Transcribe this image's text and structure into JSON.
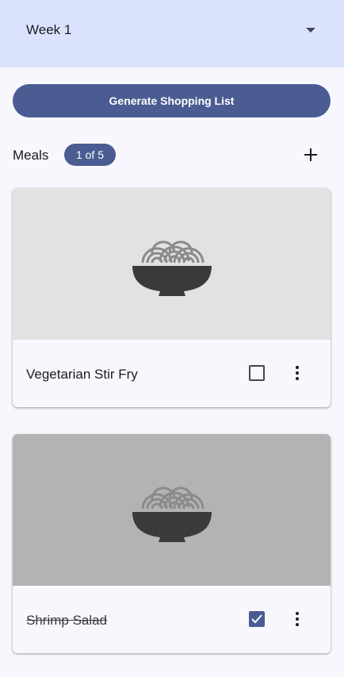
{
  "header": {
    "week_selector": "Week 1",
    "dropdown_icon": "arrow-drop-down-icon"
  },
  "actions": {
    "generate_label": "Generate Shopping List"
  },
  "meals_section": {
    "title": "Meals",
    "count_badge": "1 of 5",
    "add_icon": "plus-icon"
  },
  "meals": [
    {
      "name": "Vegetarian Stir Fry",
      "checked": false,
      "image_icon": "noodle-bowl-icon",
      "image_bg": "#e2e2e2"
    },
    {
      "name": "Shrimp Salad",
      "checked": true,
      "image_icon": "noodle-bowl-icon",
      "image_bg": "#b3b3b3"
    }
  ],
  "colors": {
    "primary": "#4a5c92",
    "header_bg": "#dbe2fd",
    "surface": "#f8f7fd"
  }
}
